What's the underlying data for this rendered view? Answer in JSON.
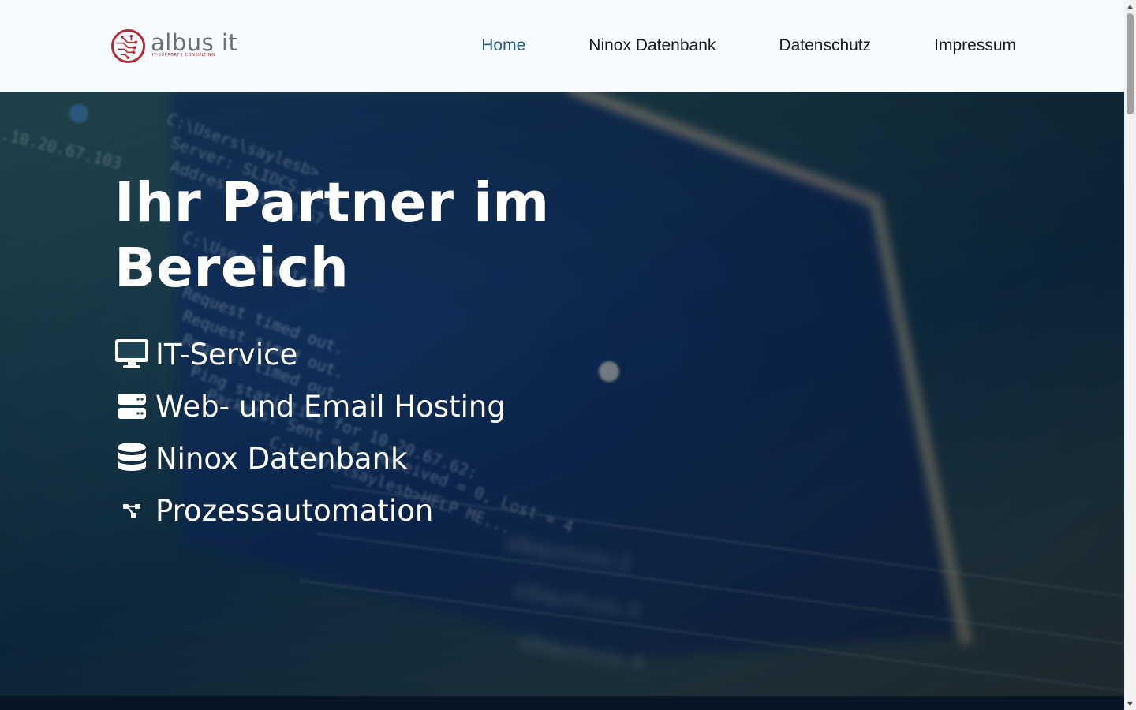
{
  "header": {
    "logo": {
      "name": "albus it",
      "tagline": "IT-SUPPORT | CONSULTING"
    },
    "nav": [
      {
        "label": "Home",
        "active": true
      },
      {
        "label": "Ninox Datenbank",
        "active": false
      },
      {
        "label": "Datenschutz",
        "active": false
      },
      {
        "label": "Impressum",
        "active": false
      }
    ]
  },
  "hero": {
    "title_line1": "Ihr Partner im",
    "title_line2": "Bereich",
    "services": [
      {
        "label": "IT-Service",
        "icon": "desktop-icon"
      },
      {
        "label": "Web- und Email Hosting",
        "icon": "server-icon"
      },
      {
        "label": "Ninox Datenbank",
        "icon": "database-icon"
      },
      {
        "label": "Prozessautomation",
        "icon": "workflow-icon"
      }
    ]
  },
  "colors": {
    "header_bg": "#f7fafe",
    "nav_active": "#1e5a8c",
    "nav_text": "#1b1b1b",
    "logo_red": "#b62a2f",
    "hero_text": "#ffffff",
    "footer_bg": "#061424"
  }
}
